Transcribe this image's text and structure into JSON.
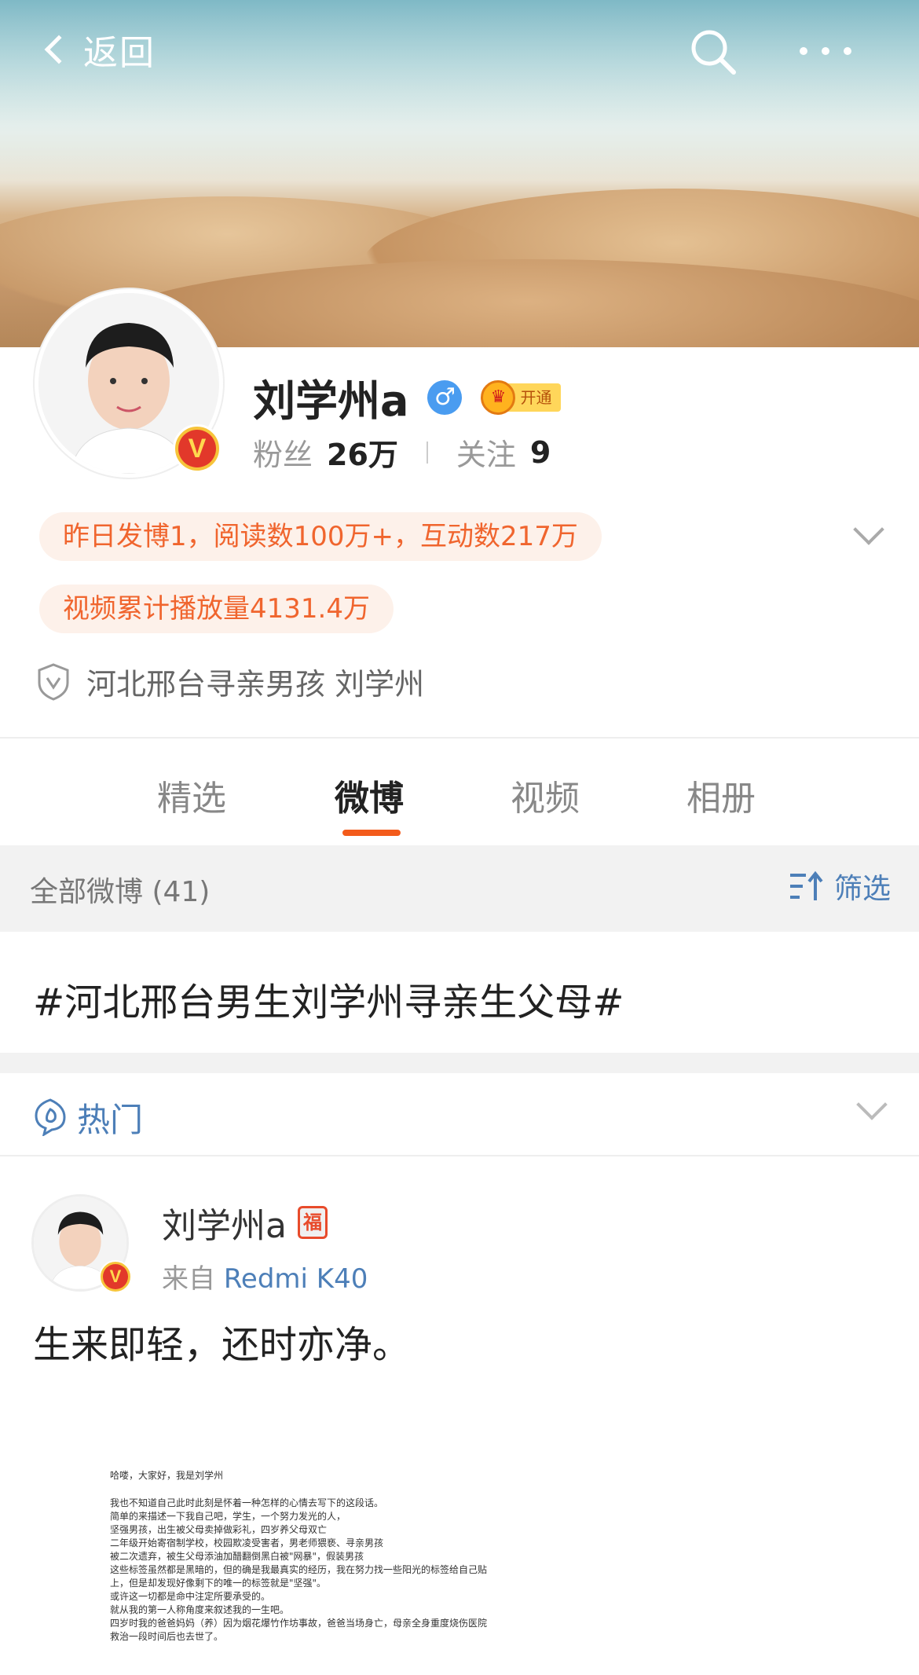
{
  "nav": {
    "back_label": "返回"
  },
  "profile": {
    "name": "刘学州a",
    "gender_symbol": "♂",
    "vip_label": "开通",
    "verify_mark": "V",
    "fans_label": "粉丝",
    "fans_count": "26万",
    "following_label": "关注",
    "following_count": "9",
    "stats_pill_1": "昨日发博1，阅读数100万+，互动数217万",
    "stats_pill_2": "视频累计播放量4131.4万",
    "verify_desc": "河北邢台寻亲男孩 刘学州"
  },
  "tabs": [
    {
      "label": "精选",
      "active": false
    },
    {
      "label": "微博",
      "active": true
    },
    {
      "label": "视频",
      "active": false
    },
    {
      "label": "相册",
      "active": false
    }
  ],
  "filter_bar": {
    "all_label": "全部微博 (41)",
    "filter_label": "筛选"
  },
  "topic": "#河北邢台男生刘学州寻亲生父母#",
  "hot": {
    "label": "热门"
  },
  "post": {
    "author": "刘学州a",
    "badge": "福",
    "source_prefix": "来自",
    "source_device": "Redmi K40",
    "text": "生来即轻，还时亦净。",
    "image_doc_lines": [
      "哈喽，大家好，我是刘学州",
      "我也不知道自己此时此刻是怀着一种怎样的心情去写下的这段话。",
      "简单的来描述一下我自己吧，学生，一个努力发光的人，",
      "坚强男孩，出生被父母卖掉做彩礼，四岁养父母双亡",
      "二年级开始寄宿制学校，校园欺凌受害者，男老师猥亵、寻亲男孩",
      "被二次遗弃，被生父母添油加醋翻倒黑白被\"网暴\"，假装男孩",
      "这些标签虽然都是黑暗的，但的确是我最真实的经历，我在努力找一些阳光的标签给自己贴",
      "上，但是却发现好像剩下的唯一的标签就是\"坚强\"。",
      "或许这一切都是命中注定所要承受的。",
      "就从我的第一人称角度来叙述我的一生吧。",
      "四岁时我的爸爸妈妈（养）因为烟花爆竹作坊事故，爸爸当场身亡，母亲全身重度烧伤医院",
      "救治一段时间后也去世了。"
    ]
  },
  "colors": {
    "accent_orange": "#f35b1b",
    "link_blue": "#4d7fb8",
    "pill_bg": "#fdf1ea",
    "pill_text": "#f0652e"
  }
}
